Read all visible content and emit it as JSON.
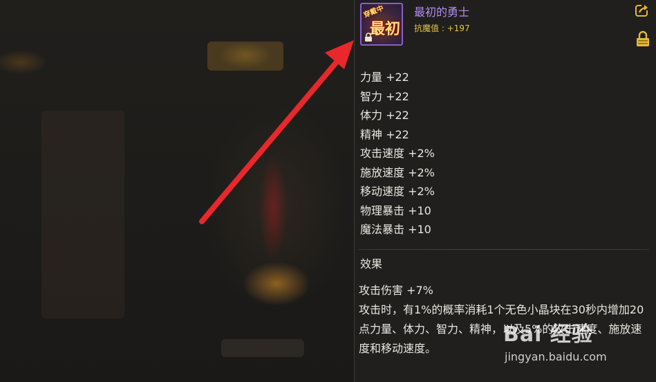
{
  "item": {
    "name": "最初的勇士",
    "resist_label": "抗魔值 : +197",
    "icon_badge": "穿戴中",
    "icon_text": "最初",
    "icon_name": "title-icon",
    "rarity_color": "#b38cf2"
  },
  "stats": [
    "力量 +22",
    "智力 +22",
    "体力 +22",
    "精神 +22",
    "攻击速度 +2%",
    "施放速度 +2%",
    "移动速度 +2%",
    "物理暴击 +10",
    "魔法暴击 +10"
  ],
  "effect": {
    "title": "效果",
    "lines": [
      "攻击伤害 +7%",
      "攻击时，有1%的概率消耗1个无色小晶块在30秒内增加20点力量、体力、智力、精神，以及5%的攻击速度、施放速度和移动速度。"
    ]
  },
  "watermark": {
    "logo": "Bai 经验",
    "url": "jingyan.baidu.com"
  },
  "annotation": {
    "arrow_color": "#e8282a"
  }
}
